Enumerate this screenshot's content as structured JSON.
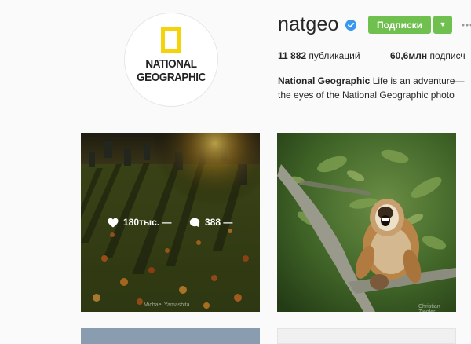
{
  "profile": {
    "username": "natgeo",
    "verified_icon": "verified-badge-icon",
    "follow_label": "Подписки",
    "dropdown_icon": "chevron-down-icon",
    "more_icon": "more-options-icon",
    "avatar": {
      "logo_line1": "NATIONAL",
      "logo_line2": "GEOGRAPHIC"
    },
    "stats": {
      "posts_count": "11 882",
      "posts_label": "публикаций",
      "followers_count": "60,6млн",
      "followers_label": "подписч"
    },
    "bio": {
      "name": "National Geographic",
      "line1": "Life is an adventure—",
      "line2": "the eyes of the National Geographic photo"
    }
  },
  "posts": [
    {
      "likes": "180тыс. —",
      "comments": "388 —",
      "credit": "Michael Yamashita",
      "like_icon": "heart-icon",
      "comment_icon": "comment-bubble-icon"
    },
    {
      "credit": "Christian Ziegler"
    }
  ],
  "colors": {
    "accent": "#70c050",
    "verified": "#3897f0",
    "logo_yellow": "#f5d20a"
  }
}
